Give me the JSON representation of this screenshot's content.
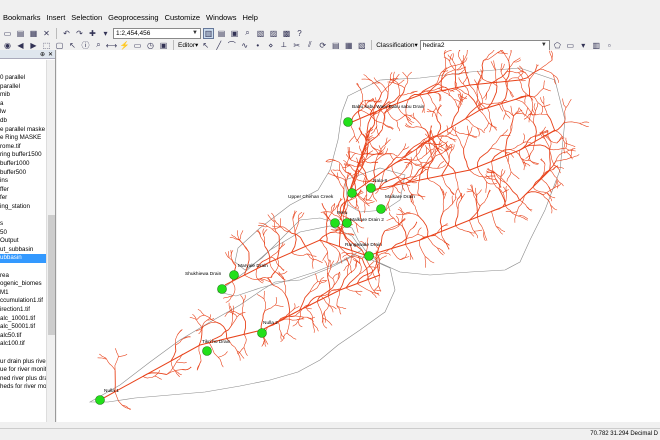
{
  "menu": [
    "Bookmarks",
    "Insert",
    "Selection",
    "Geoprocessing",
    "Customize",
    "Windows",
    "Help"
  ],
  "toolbar": {
    "scale": "1:2,454,456",
    "editor_label": "Editor▾",
    "classification_label": "Classification▾",
    "classification_layer": "hedira2"
  },
  "toc": {
    "layers": [
      {
        "label": "0 parallel",
        "selected": false
      },
      {
        "label": "parallel",
        "selected": false
      },
      {
        "label": "mib",
        "selected": false
      },
      {
        "label": "a",
        "selected": false
      },
      {
        "label": "lw",
        "selected": false
      },
      {
        "label": "db",
        "selected": false
      },
      {
        "label": "e parallel maske",
        "selected": false
      },
      {
        "label": "e Ring MASKE",
        "selected": false
      },
      {
        "label": "rome.tif",
        "selected": false
      },
      {
        "label": "ring buffer1500",
        "selected": false
      },
      {
        "label": "buffer1000",
        "selected": false
      },
      {
        "label": "buffer500",
        "selected": false
      },
      {
        "label": "ins",
        "selected": false
      },
      {
        "label": "ffer",
        "selected": false
      },
      {
        "label": "fer",
        "selected": false
      },
      {
        "label": "ing_station",
        "selected": false
      },
      {
        "label": "",
        "selected": false
      },
      {
        "label": "s",
        "selected": false
      },
      {
        "label": "50",
        "selected": false
      },
      {
        "label": "Output",
        "selected": false
      },
      {
        "label": "ut_subbasin",
        "selected": false
      },
      {
        "label": "ubbasin",
        "selected": true
      },
      {
        "label": "",
        "selected": false
      },
      {
        "label": "rea",
        "selected": false
      },
      {
        "label": "ogenic_biomes",
        "selected": false
      },
      {
        "label": "M1",
        "selected": false
      },
      {
        "label": "ccumulation1.tif",
        "selected": false
      },
      {
        "label": "irection1.tif",
        "selected": false
      },
      {
        "label": "alc_10001.tif",
        "selected": false
      },
      {
        "label": "alc_50001.tif",
        "selected": false
      },
      {
        "label": "alc50.tif",
        "selected": false
      },
      {
        "label": "alc100.tif",
        "selected": false
      },
      {
        "label": "",
        "selected": false
      },
      {
        "label": "ur drain plus river",
        "selected": false
      },
      {
        "label": "ue for river monitc",
        "selected": false
      },
      {
        "label": "ned river plus drair",
        "selected": false
      },
      {
        "label": "heds for river moni",
        "selected": false
      }
    ]
  },
  "map": {
    "stations": [
      {
        "name": "Babu sabu Wae/ Babu sabu Drain"
      },
      {
        "name": "Nala-8"
      },
      {
        "name": "Upper Chehan Creek"
      },
      {
        "name": "Malkare Drain"
      },
      {
        "name": "Reru"
      },
      {
        "name": "Malkare Drain 2"
      },
      {
        "name": "Rangewale Drain"
      },
      {
        "name": "Maryale Drain"
      },
      {
        "name": "Shukhiewa Drain"
      },
      {
        "name": "Nulla 2"
      },
      {
        "name": "Tikri ho Drain"
      },
      {
        "name": "Nulla 1"
      }
    ],
    "river_color": "#e8431b",
    "station_color": "#22e01a"
  },
  "status": {
    "coordinates": "70.782  31.294 Decimal D"
  }
}
